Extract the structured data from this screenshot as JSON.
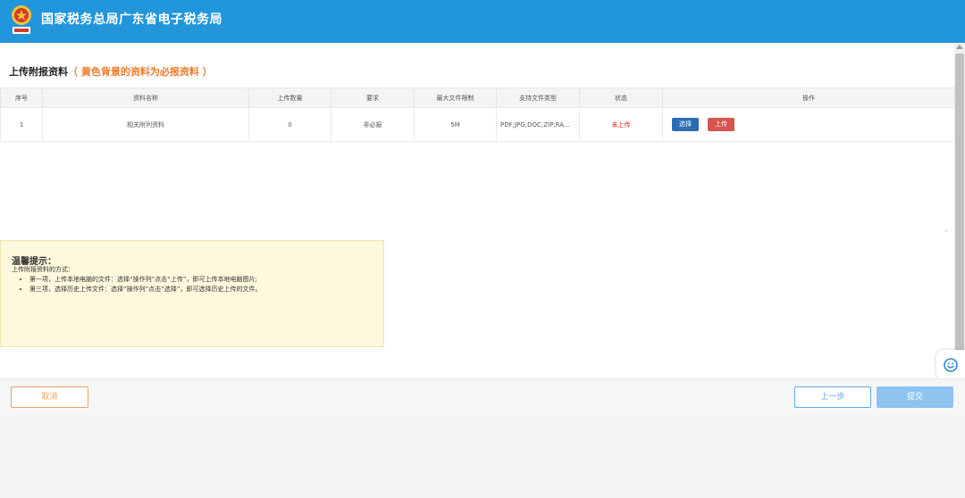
{
  "header": {
    "site_title": "国家税务总局广东省电子税务局",
    "logo_icon": "tax-bureau-emblem-icon"
  },
  "section": {
    "title": "上传附报资料",
    "note": "（ 黄色背景的资料为必报资料 ）"
  },
  "table": {
    "columns": [
      "序号",
      "资料名称",
      "上传数量",
      "要求",
      "最大文件限制",
      "支持文件类型",
      "状态",
      "操作"
    ],
    "rows": [
      {
        "index": "1",
        "name": "相关附列资料",
        "count": "0",
        "requirement": "非必报",
        "max_size": "5M",
        "file_types": "PDF;JPG;DOC;ZIP;RA...",
        "status": "未上传",
        "select_label": "选择",
        "upload_label": "上传"
      }
    ]
  },
  "tips": {
    "title": "温馨提示：",
    "intro": "上传附报资料的方式：",
    "items": [
      "第一项，上传本地电脑的文件：选择“操作列”点击“上传”，即可上传本地电脑图片;",
      "第三项，选择历史上传文件：选择“操作列”点击“选择”，即可选择历史上传的文件。"
    ]
  },
  "footer": {
    "cancel_label": "取消",
    "prev_label": "上一步",
    "submit_label": "提交"
  },
  "colors": {
    "header_bg": "#2196db",
    "note_orange": "#f07a2a",
    "status_red": "#e02020",
    "select_blue": "#2a6db4",
    "upload_red": "#d9534f",
    "tips_bg": "#fef8dd"
  }
}
